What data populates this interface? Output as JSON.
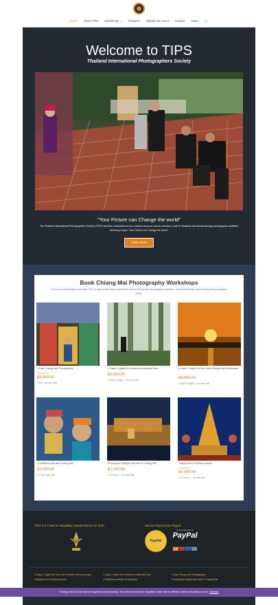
{
  "nav": {
    "items": [
      "Home",
      "About TIPS",
      "Workshops",
      "Products",
      "Validate the event",
      "Contact",
      "News"
    ],
    "active": "Home",
    "cart_icon": "cart-icon",
    "logo_icon": "tips-logo"
  },
  "hero": {
    "title": "Welcome to TIPS",
    "subtitle": "Thailand International Photographers Society",
    "quote": "\"Your Picture can Change the world\"",
    "description": "The Thailand International Photographers Society (TIPS) has been established to be a central resource tool for members, both in Thailand and abroad through photographic activities following slogan \"Your Picture can Change the world\"",
    "button": "Learn More"
  },
  "workshops": {
    "title": "Book Chiang Mai Photography Workshops",
    "intro": "If you love photography and want TIPS to stay please help support this club by joining any photography workshop. See you tell learn and having great photograph shots.",
    "products": [
      {
        "name": "1 Day Chiang Mai Photography",
        "stars": "★★★★★",
        "price": "฿2,500.00",
        "meta": "9.00 ✓ for rate Stat"
      },
      {
        "name": "2 Days 1 Night Doi Inthanond National Park",
        "stars": "",
        "price": "฿5,500.00",
        "meta": "2 Days 1 Night ✓ for rate Stat"
      },
      {
        "name": "2 Days 1 Night Doi Tao Lake lifestyle and landscape",
        "stars": "",
        "price": "฿5,500.00",
        "meta": "2 Days 1 Night ✓ for rate Stat"
      },
      {
        "name": "3 Hilltribes portraits Chiang Mai",
        "stars": "",
        "price": "฿1,500.00",
        "meta": "3 ✓ for Care Stat"
      },
      {
        "name": "Photograph twilight city wall of Chiang Mai",
        "stars": "",
        "price": "฿1,200.00",
        "meta": "2.00 hours ✓ for rate Stat"
      },
      {
        "name": "Twilight at Doi Suthep temple",
        "stars": "★★★★★",
        "price": "฿1,500.00",
        "meta": "2.00 hours ✓ for rate Stat"
      }
    ]
  },
  "footer": {
    "award_text": "TIPS is a Travel & Hospitality Awards Winner for 2021",
    "payment_text": "Secure Payment by Paypal",
    "paypal_seal": "PayPal",
    "paypal_top": "Secure Payment by",
    "paypal_word": "PayPal",
    "paypal_bottom": "NO PAYPAL ACCOUNT NEEDED",
    "links": [
      "2 Days 1 Night Doi Tao Lake lifestyle and landscape",
      "2 Days 1 Night Doi Inthanond National Park",
      "1 day Chiang Mai Photography",
      "Twilight at Doi Suthep temple",
      "3 Hilltribes portraits Chiang Mai",
      "Photograph twilight city wall of Chiang Mai"
    ]
  },
  "covid_bar": {
    "text": "During Covid-19 we cannot organize any workshop. You still can book but departure date will be defined until the situation is over.",
    "dismiss": "Dismiss"
  },
  "colors": {
    "accent": "#e0821d",
    "dark_bg": "#232a31",
    "section_bg": "#2f3d54",
    "covid_bar": "#6b4c9e"
  }
}
